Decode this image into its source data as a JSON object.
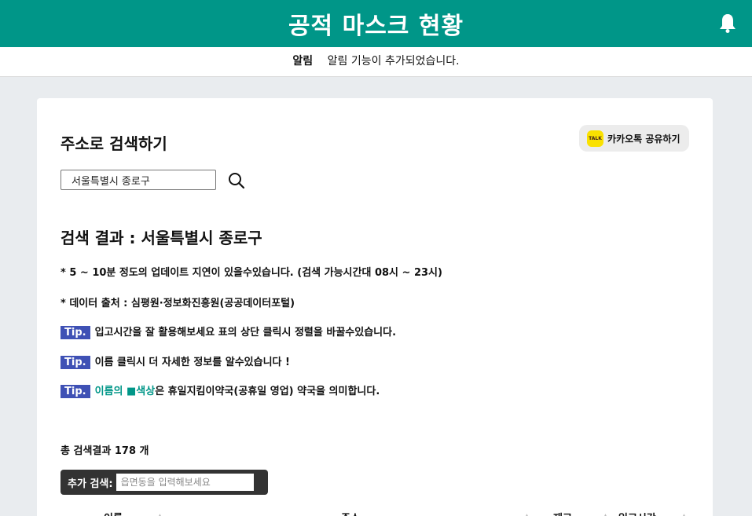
{
  "header": {
    "title": "공적 마스크 현황",
    "bell_icon": "bell-icon"
  },
  "notice": {
    "label": "알림",
    "message": "알림 기능이 추가되었습니다."
  },
  "search_section": {
    "title": "주소로 검색하기",
    "kakao_share_label": "카카오톡 공유하기",
    "kakao_logo_text": "TALK",
    "address_value": "서울특별시 종로구",
    "search_icon": "search-icon"
  },
  "results": {
    "title": "검색 결과 : 서울특별시 종로구",
    "update_note": "* 5 ~ 10분 정도의 업데이트 지연이 있을수있습니다. (검색 가능시간대 08시 ~ 23시)",
    "data_source": "* 데이터 출처 : 심평원·정보화진흥원(공공데이터포털)",
    "tips": [
      {
        "badge": "Tip.",
        "text": "입고시간을 잘 활용해보세요 표의 상단 클릭시 정렬을 바꿀수있습니다."
      },
      {
        "badge": "Tip.",
        "text": "이름 클릭시 더 자세한 정보를 알수있습니다 !"
      },
      {
        "badge": "Tip.",
        "colored_text": "이름의 ■색상",
        "text": "은 휴일지킴이약국(공휴일 영업) 약국을 의미합니다."
      }
    ],
    "total_count": "총 검색결과 178 개",
    "extra_search": {
      "label": "추가 검색:",
      "placeholder": "읍면동을 입력해보세요"
    },
    "table_headers": [
      "이름",
      "주소",
      "재고",
      "입고시간"
    ]
  },
  "colors": {
    "header_bg": "#009688",
    "tip_badge_bg": "#3f51b5",
    "holiday_pharmacy": "#009688",
    "kakao_yellow": "#fae100"
  }
}
